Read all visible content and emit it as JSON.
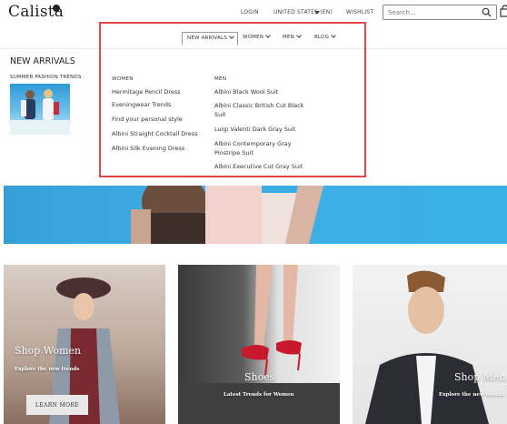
{
  "header": {
    "logo": "Calista",
    "login": "LOGIN",
    "country": "UNITED STATES (EN)",
    "wishlist": "WISHLIST",
    "search_placeholder": "Search..."
  },
  "nav": {
    "items": [
      {
        "label": "NEW ARRIVALS"
      },
      {
        "label": "WOMEN"
      },
      {
        "label": "MEN"
      },
      {
        "label": "BLOG"
      }
    ]
  },
  "megamenu": {
    "title": "NEW ARRIVALS",
    "subtitle": "SUMMER FASHION TRENDS",
    "women": {
      "heading": "WOMEN",
      "links": [
        "Hermitage Pencil Dress",
        "Eveningwear Trends",
        "Find your personal style",
        "Albini Straight Cocktail Dress",
        "Albini Silk Evening Dress"
      ]
    },
    "men": {
      "heading": "MEN",
      "links": [
        "Albini Black Wool Suit",
        "Albini Classic British Cut Black Suit",
        "Luigi Valenti Dark Gray Suit",
        "Albini Contemporary Gray Pinstripe Suit",
        "Albini Executive Cut Gray Suit"
      ]
    }
  },
  "cards": [
    {
      "title": "Shop Women",
      "subtitle": "Explore the new trends",
      "button": "LEARN MORE"
    },
    {
      "title": "Shoes",
      "subtitle": "Latest Trends for Women"
    },
    {
      "title": "Shop Men",
      "subtitle": "Explore the new trends"
    }
  ],
  "colors": {
    "highlight": "#e04747",
    "hero_blue": "#3aa8de"
  }
}
